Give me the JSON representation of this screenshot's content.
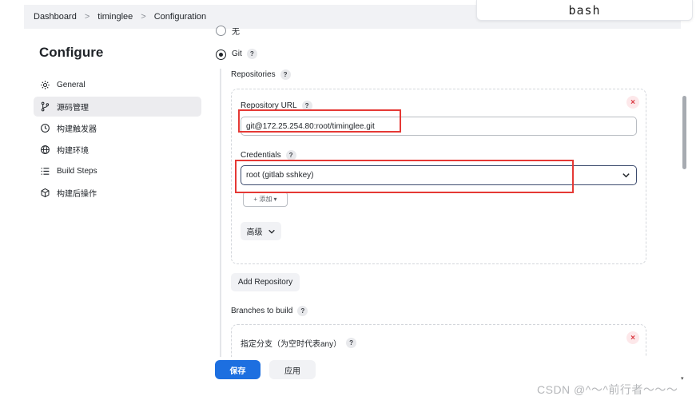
{
  "breadcrumb": {
    "items": [
      "Dashboard",
      "timinglee",
      "Configuration"
    ],
    "separator": ">"
  },
  "terminal_tab": {
    "label": "bash"
  },
  "sidebar": {
    "title": "Configure",
    "items": [
      {
        "label": "General",
        "icon": "gear-icon",
        "active": false
      },
      {
        "label": "源码管理",
        "icon": "git-branch-icon",
        "active": true
      },
      {
        "label": "构建触发器",
        "icon": "clock-icon",
        "active": false
      },
      {
        "label": "构建环境",
        "icon": "globe-icon",
        "active": false
      },
      {
        "label": "Build Steps",
        "icon": "list-icon",
        "active": false
      },
      {
        "label": "构建后操作",
        "icon": "package-icon",
        "active": false
      }
    ]
  },
  "scm": {
    "option_none_label": "无",
    "option_git_label": "Git",
    "git_selected": true,
    "repositories_label": "Repositories",
    "repository_url_label": "Repository URL",
    "repository_url_value": "git@172.25.254.80:root/timinglee.git",
    "credentials_label": "Credentials",
    "credentials_value": "root (gitlab sshkey)",
    "add_credential_label": "+ 添加 ▾",
    "advanced_label": "高级",
    "add_repository_label": "Add Repository",
    "branches_label": "Branches to build",
    "branch_specifier_label": "指定分支（为空时代表any）",
    "help_symbol": "?",
    "remove_symbol": "×"
  },
  "footer": {
    "save_label": "保存",
    "apply_label": "应用"
  },
  "watermark": "CSDN @^～^前行者～～～",
  "colors": {
    "primary": "#1d6fe0",
    "highlight_border": "#e53935",
    "remove_red": "#d9363e"
  }
}
